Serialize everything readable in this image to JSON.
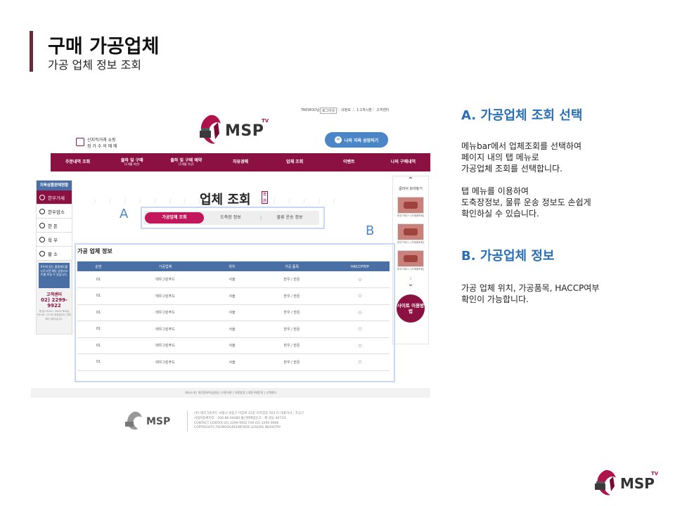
{
  "slide": {
    "title": "구매 가공업체",
    "subtitle": "가공 업체 정보 조회"
  },
  "site": {
    "topbar": {
      "user": "TAEWOO님",
      "logout": "로그아웃",
      "myinfo": "내정보",
      "qna": "1:1게시판",
      "support": "고객센터"
    },
    "logo": {
      "text": "MSP",
      "tv": "TV"
    },
    "promo": {
      "line1": "산지직거래 쇼핑",
      "line2": "정 가 수 의 매 매"
    },
    "consult_button": "나의 지육 상장하기",
    "nav": [
      {
        "label": "주문내역 조회",
        "sub": ""
      },
      {
        "label": "출하 및 구매",
        "sub": "(1개월 미만)"
      },
      {
        "label": "출하 및 구매 예약",
        "sub": "(1개월 이상)"
      },
      {
        "label": "자유경매",
        "sub": ""
      },
      {
        "label": "업체 조회",
        "sub": ""
      },
      {
        "label": "이벤트",
        "sub": ""
      },
      {
        "label": "나의 구매내역",
        "sub": ""
      }
    ],
    "left_sidebar": {
      "header": "지육상품판매현황",
      "items": [
        "한우거세",
        "한우암소",
        "한 돈",
        "육 우",
        "황 소"
      ],
      "notice": "6두에 있는 출품제도를 누르시면 해당 상품리스트를 보실 수 있습니다.",
      "cs_label": "고객센터",
      "cs_tel": "02) 2299-9922",
      "cs_hours": "평 일 09:00~18:00 토요일 09:00~13:00 공휴일이나 연휴에는 휴무입니다."
    },
    "right_sidebar": {
      "label": "골라서 모아놓기",
      "thumb_caption": "한우거세1+ [도체중조회]",
      "pager": "1",
      "guide_button": "사이트 이용방법"
    },
    "page_title": "업체 조회",
    "page_title_deco": "查詢",
    "tabs": [
      "가공업체 조회",
      "도축장 정보",
      "물류 운송 정보"
    ],
    "section_title": "가공 업체 정보",
    "table": {
      "columns": [
        "순번",
        "가공업체",
        "위치",
        "가공 품목",
        "HACCP여부"
      ],
      "rows": [
        [
          "01",
          "태우그린푸드",
          "서울",
          "한우 / 한돈",
          "○"
        ],
        [
          "01",
          "태우그린푸드",
          "서울",
          "한우 / 한돈",
          "○"
        ],
        [
          "01",
          "태우그린푸드",
          "서울",
          "한우 / 한돈",
          "○"
        ],
        [
          "01",
          "태우그린푸드",
          "서울",
          "한우 / 한돈",
          "○"
        ],
        [
          "01",
          "태우그린푸드",
          "서울",
          "한우 / 한돈",
          "○"
        ],
        [
          "01",
          "태우그린푸드",
          "서울",
          "한우 / 한돈",
          "○"
        ]
      ]
    },
    "footer": {
      "links": "회사소개 | 개인정보취급방침 | 이용약관 | 이용방법 | 대량구매문의 | 고객센터",
      "logo_text": "MSP",
      "info": [
        "(주) 태우그린푸드 서울시 성동구 마장로 33길 7(마장동 503-5) 대표이사 : 조규근",
        "사업자등록번호 : 206-86-04480 통신판매업신고 : 제 성동-4073호",
        "CONTACT CENTER 02) 2299-9922 FAX 02) 2295-9966",
        "COPYRIGHTS TAEWOOGREENFOOD LEISURE INDUSTRY"
      ]
    },
    "highlights": {
      "a": "A",
      "b": "B"
    }
  },
  "explanation": {
    "a_title": "A. 가공업체 조회 선택",
    "a_lines": [
      "메뉴bar에서 업체조회를 선택하여",
      "페이지 내의 탭 메뉴로",
      "가공업체 조회를 선택합니다.",
      "",
      "탭 메뉴를 이용하여",
      "도축장정보, 물류 운송 정보도 손쉽게",
      "확인하실 수 있습니다."
    ],
    "b_title": "B. 가공업체 정보",
    "b_lines": [
      "가공 업체 위치, 가공품목, HACCP여부",
      "확인이 가능합니다."
    ]
  },
  "corner_logo": {
    "text": "MSP",
    "tv": "TV"
  },
  "colors": {
    "brand": "#8a1141",
    "accent_blue": "#2a6fb5",
    "table_header": "#4a6fa5",
    "tab_active": "#c2185b"
  }
}
